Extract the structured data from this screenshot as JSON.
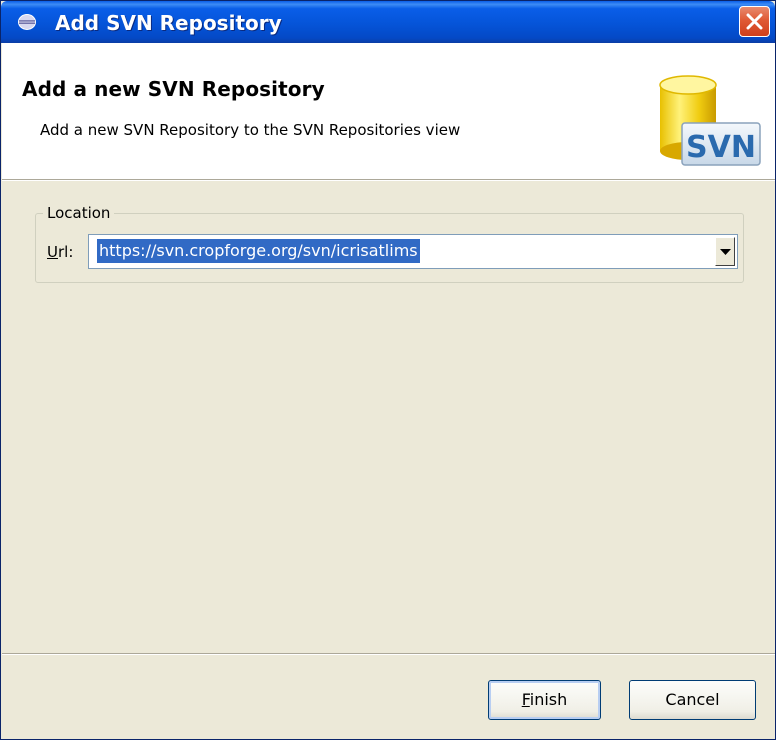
{
  "window": {
    "title": "Add SVN Repository",
    "close_glyph": "✕"
  },
  "banner": {
    "title": "Add a new SVN Repository",
    "description": "Add a new SVN Repository to the SVN Repositories view",
    "logo_text": "SVN"
  },
  "location": {
    "legend": "Location",
    "url_label_mnemonic": "U",
    "url_label_rest": "rl:",
    "url_value": "https://svn.cropforge.org/svn/icrisatlims"
  },
  "buttons": {
    "finish_mnemonic": "F",
    "finish_rest": "inish",
    "cancel_label": "Cancel"
  },
  "colors": {
    "titlebar": "#0554d8",
    "dialog_bg": "#ece9d8",
    "selection": "#316ac5",
    "close_red": "#e05a35"
  }
}
